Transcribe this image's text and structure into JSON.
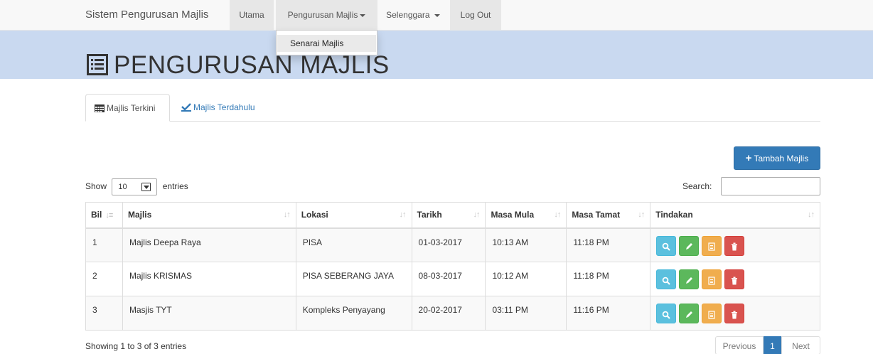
{
  "navbar": {
    "brand": "Sistem Pengurusan Majlis",
    "items": [
      {
        "label": "Utama"
      },
      {
        "label": "Pengurusan Majlis"
      },
      {
        "label": "Selenggara"
      },
      {
        "label": "Log Out"
      }
    ],
    "dropdown": {
      "items": [
        {
          "label": "Senarai Majlis"
        }
      ]
    }
  },
  "header": {
    "title": "PENGURUSAN MAJLIS",
    "icon": "list-alt-icon"
  },
  "tabs": [
    {
      "label": "Majlis Terkini",
      "icon": "calendar-icon",
      "active": true
    },
    {
      "label": "Majlis Terdahulu",
      "icon": "check-icon",
      "active": false
    }
  ],
  "add_button": {
    "label": "Tambah Majlis",
    "icon": "plus-icon"
  },
  "table_controls": {
    "show_label": "Show",
    "entries_label": "entries",
    "length_value": "10",
    "search_label": "Search:",
    "search_value": ""
  },
  "table": {
    "columns": [
      "Bil",
      "Majlis",
      "Lokasi",
      "Tarikh",
      "Masa Mula",
      "Masa Tamat",
      "Tindakan"
    ],
    "rows": [
      {
        "bil": "1",
        "majlis": "Majlis Deepa Raya",
        "lokasi": "PISA",
        "tarikh": "01-03-2017",
        "mula": "10:13 AM",
        "tamat": "11:18 PM"
      },
      {
        "bil": "2",
        "majlis": "Majlis KRISMAS",
        "lokasi": "PISA SEBERANG JAYA",
        "tarikh": "08-03-2017",
        "mula": "10:12 AM",
        "tamat": "11:18 PM"
      },
      {
        "bil": "3",
        "majlis": "Masjis TYT",
        "lokasi": "Kompleks Penyayang",
        "tarikh": "20-02-2017",
        "mula": "03:11 PM",
        "tamat": "11:16 PM"
      }
    ],
    "actions": [
      "search-icon",
      "pencil-icon",
      "document-icon",
      "trash-icon"
    ]
  },
  "footer": {
    "info": "Showing 1 to 3 of 3 entries",
    "prev_label": "Previous",
    "current_page": "1",
    "next_label": "Next"
  },
  "colors": {
    "header_band": "#c9d9f0",
    "primary": "#337ab7",
    "info": "#5bc0de",
    "success": "#5cb85c",
    "warning": "#f0ad4e",
    "danger": "#d9534f"
  }
}
